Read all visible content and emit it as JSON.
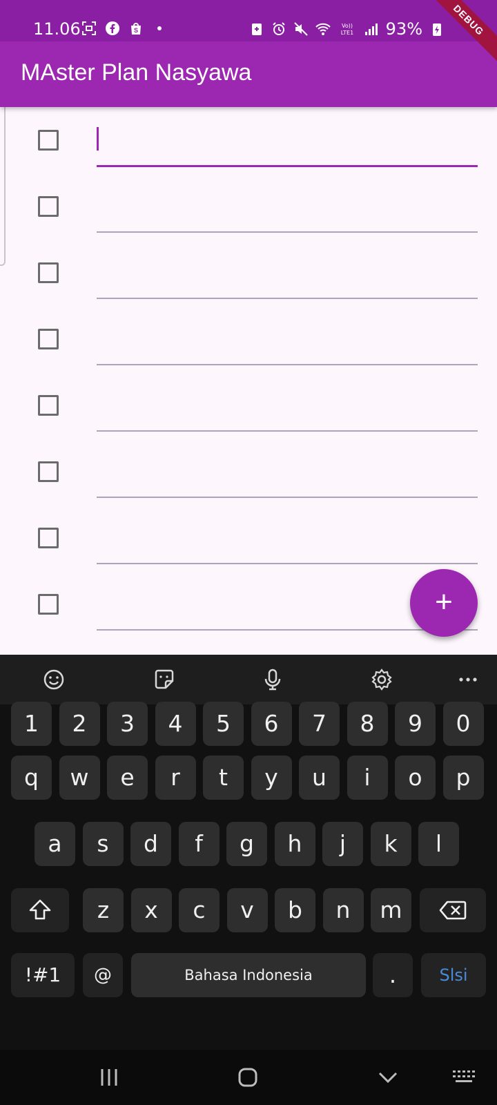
{
  "status_bar": {
    "time": "11.06",
    "battery": "93%",
    "left_icons": [
      "screenshot-icon",
      "facebook-icon",
      "shopee-icon",
      "dot-icon"
    ],
    "right_icons": [
      "smart-manager-icon",
      "alarm-icon",
      "mute-icon",
      "wifi-icon",
      "volte-icon",
      "signal-icon",
      "charging-icon"
    ],
    "network_label": "Vo) LTE1"
  },
  "debug_banner": "DEBUG",
  "app_bar": {
    "title": "MAster Plan Nasyawa"
  },
  "tasks": [
    {
      "done": false,
      "text": "",
      "focused": true
    },
    {
      "done": false,
      "text": "",
      "focused": false
    },
    {
      "done": false,
      "text": "",
      "focused": false
    },
    {
      "done": false,
      "text": "",
      "focused": false
    },
    {
      "done": false,
      "text": "",
      "focused": false
    },
    {
      "done": false,
      "text": "",
      "focused": false
    },
    {
      "done": false,
      "text": "",
      "focused": false
    },
    {
      "done": false,
      "text": "",
      "focused": false
    }
  ],
  "fab": {
    "label": "+",
    "icon": "add-icon"
  },
  "colors": {
    "primary": "#9c27b0",
    "background": "#fdf7fd",
    "keyboard": "#111111",
    "key": "#2e2e2e",
    "accent_key": "#4a8bd8"
  },
  "keyboard": {
    "toolbar": [
      "emoji-icon",
      "sticker-icon",
      "microphone-icon",
      "settings-icon",
      "more-icon"
    ],
    "rows": [
      [
        "1",
        "2",
        "3",
        "4",
        "5",
        "6",
        "7",
        "8",
        "9",
        "0"
      ],
      [
        "q",
        "w",
        "e",
        "r",
        "t",
        "y",
        "u",
        "i",
        "o",
        "p"
      ],
      [
        "a",
        "s",
        "d",
        "f",
        "g",
        "h",
        "j",
        "k",
        "l"
      ],
      [
        "z",
        "x",
        "c",
        "v",
        "b",
        "n",
        "m"
      ]
    ],
    "shift_icon": "shift-icon",
    "backspace_icon": "backspace-icon",
    "symbols_label": "!#1",
    "at_label": "@",
    "space_label": "Bahasa Indonesia",
    "period_label": ".",
    "action_label": "Slsi"
  },
  "nav_bar": [
    "recents-icon",
    "home-icon",
    "back-icon",
    "keyboard-switch-icon"
  ]
}
